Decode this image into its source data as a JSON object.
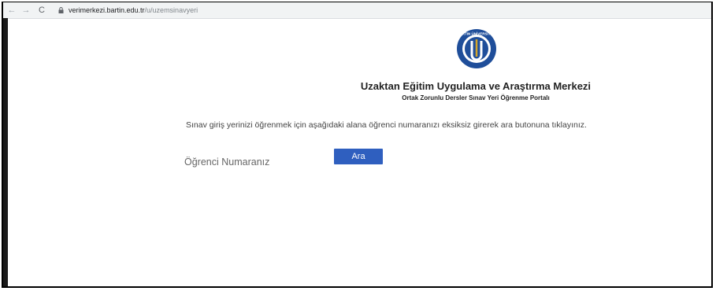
{
  "browser": {
    "url_domain": "verimerkezi.bartin.edu.tr",
    "url_path": "/u/uzemsinavyeri",
    "back_icon": "←",
    "forward_icon": "→",
    "reload_icon": "C"
  },
  "logo": {
    "text": "BARTIN ÜNİVERSİTESİ",
    "brand_color": "#1f4e9a",
    "gold_color": "#d4a52a"
  },
  "header": {
    "title": "Uzaktan Eğitim Uygulama ve Araştırma Merkezi",
    "subtitle": "Ortak Zorunlu Dersler Sınav Yeri Öğrenme Portalı"
  },
  "instruction": "Sınav giriş yerinizi öğrenmek için aşağıdaki alana öğrenci numaranızı eksiksiz girerek ara butonuna tıklayınız.",
  "form": {
    "student_number_label": "Öğrenci Numaranız",
    "search_button": "Ara"
  }
}
